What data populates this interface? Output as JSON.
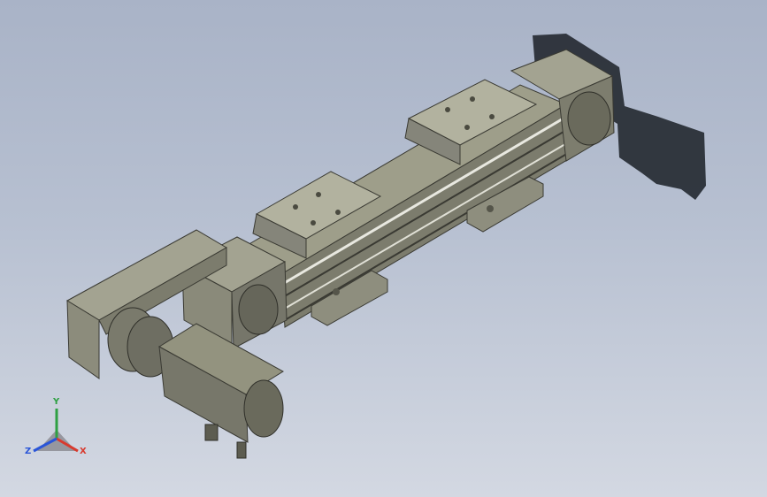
{
  "viewport": {
    "colors": {
      "background_top": "#a9b3c7",
      "background_bottom": "#d3d8e2",
      "metal": "#8a8a7a",
      "shadow": "#262b33"
    }
  },
  "triad": {
    "axes": [
      {
        "label": "Y",
        "color": "#2ea043"
      },
      {
        "label": "X",
        "color": "#d83a2e"
      },
      {
        "label": "Z",
        "color": "#2a55d8"
      }
    ]
  }
}
